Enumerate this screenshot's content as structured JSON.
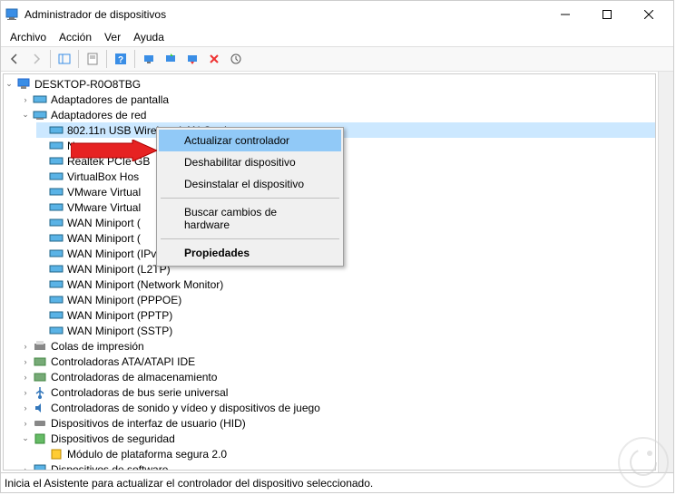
{
  "window": {
    "title": "Administrador de dispositivos"
  },
  "menubar": {
    "file": "Archivo",
    "action": "Acción",
    "view": "Ver",
    "help": "Ayuda"
  },
  "tree": {
    "root": "DESKTOP-R0O8TBG",
    "display_adapters": "Adaptadores de pantalla",
    "network_adapters": "Adaptadores de red",
    "net": {
      "n0": "802.11n USB Wireless LAN Card",
      "n1": "Npcap",
      "n2": "Realtek PCIe GB",
      "n3": "VirtualBox Hos",
      "n4": "VMware Virtual",
      "n5": "VMware Virtual",
      "n6": "WAN Miniport (",
      "n7": "WAN Miniport (",
      "n8": "WAN Miniport (IPv6)",
      "n9": "WAN Miniport (L2TP)",
      "n10": "WAN Miniport (Network Monitor)",
      "n11": "WAN Miniport (PPPOE)",
      "n12": "WAN Miniport (PPTP)",
      "n13": "WAN Miniport (SSTP)"
    },
    "print_queues": "Colas de impresión",
    "ata_ide": "Controladoras ATA/ATAPI IDE",
    "storage": "Controladoras de almacenamiento",
    "usb": "Controladoras de bus serie universal",
    "sound": "Controladoras de sonido y vídeo y dispositivos de juego",
    "hid": "Dispositivos de interfaz de usuario (HID)",
    "security": "Dispositivos de seguridad",
    "tpm": "Módulo de plataforma segura 2.0",
    "software": "Dispositivos de software"
  },
  "context_menu": {
    "update": "Actualizar controlador",
    "disable": "Deshabilitar dispositivo",
    "uninstall": "Desinstalar el dispositivo",
    "scan": "Buscar cambios de hardware",
    "properties": "Propiedades"
  },
  "statusbar": {
    "text": "Inicia el Asistente para actualizar el controlador del dispositivo seleccionado."
  }
}
